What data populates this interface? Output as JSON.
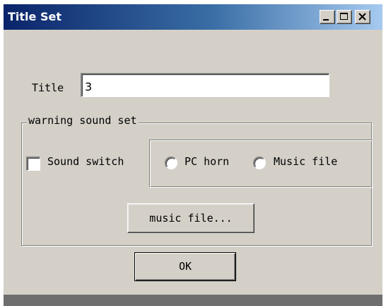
{
  "window": {
    "title": "Title Set",
    "controls": {
      "minimize_icon": "minimize-icon",
      "maximize_icon": "maximize-icon",
      "close_icon": "close-icon"
    }
  },
  "form": {
    "title_label": "Title",
    "title_value": "3"
  },
  "warning_group": {
    "legend": "warning sound set",
    "sound_switch_label": "Sound switch",
    "sound_switch_checked": false,
    "radio_pc_label": "PC horn",
    "radio_music_label": "Music file",
    "music_file_button": "music file...",
    "ok_button": "OK"
  },
  "colors": {
    "face": "#d4d0c8",
    "titlebar_start": "#0a246a",
    "titlebar_end": "#a6caf0"
  }
}
